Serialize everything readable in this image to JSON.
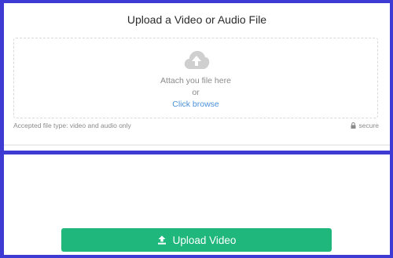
{
  "upload_panel": {
    "title": "Upload a Video or Audio File",
    "dropzone": {
      "icon": "cloud-upload-icon",
      "attach_text": "Attach you file here",
      "or_text": "or",
      "browse_link": "Click browse"
    },
    "accepted_types": "Accepted file type: video and audio only",
    "secure_label": "secure",
    "secure_icon": "lock-icon"
  },
  "action": {
    "upload_button_label": "Upload Video",
    "upload_icon": "upload-icon",
    "button_color": "#1fb77c"
  },
  "colors": {
    "background": "#3d3bd3",
    "link": "#4a90d9"
  }
}
